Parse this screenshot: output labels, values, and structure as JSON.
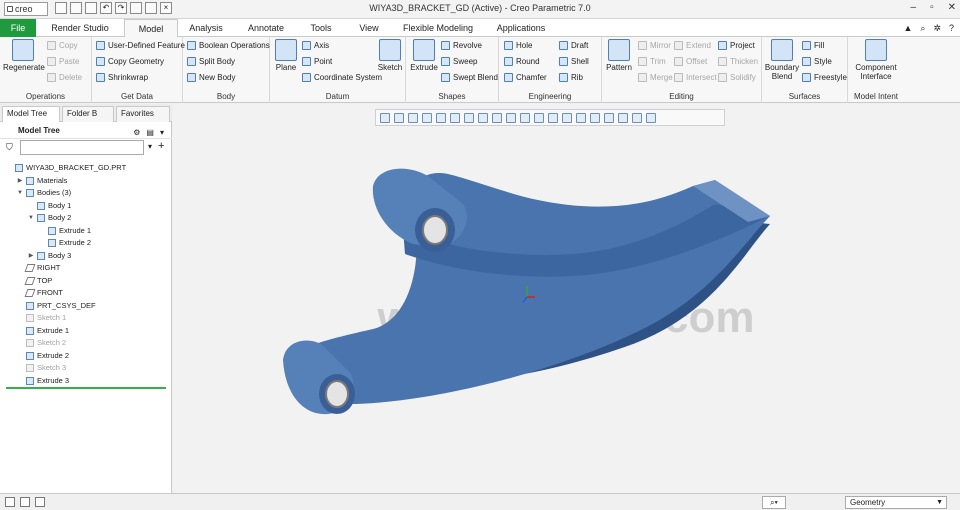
{
  "app": {
    "logo": "creo",
    "window_title": "WIYA3D_BRACKET_GD (Active) - Creo Parametric 7.0",
    "window_controls": [
      "–",
      "▫",
      "✕"
    ]
  },
  "tabs": {
    "file": "File",
    "items": [
      "Render Studio",
      "Model",
      "Analysis",
      "Annotate",
      "Tools",
      "View",
      "Flexible Modeling",
      "Applications"
    ],
    "active": "Model"
  },
  "ribbon": {
    "operations": {
      "label": "Operations",
      "regenerate": "Regenerate",
      "copy": "Copy",
      "paste": "Paste",
      "delete": "Delete"
    },
    "get_data": {
      "label": "Get Data",
      "user_defined": "User-Defined Feature",
      "copy_geometry": "Copy Geometry",
      "shrinkwrap": "Shrinkwrap"
    },
    "body": {
      "label": "Body",
      "boolean": "Boolean Operations",
      "split": "Split Body",
      "new": "New Body"
    },
    "datum": {
      "label": "Datum",
      "plane": "Plane",
      "axis": "Axis",
      "point": "Point",
      "csys": "Coordinate System",
      "sketch": "Sketch"
    },
    "shapes": {
      "label": "Shapes",
      "extrude": "Extrude",
      "revolve": "Revolve",
      "sweep": "Sweep",
      "swept_blend": "Swept Blend"
    },
    "engineering": {
      "label": "Engineering",
      "hole": "Hole",
      "draft": "Draft",
      "round": "Round",
      "shell": "Shell",
      "chamfer": "Chamfer",
      "rib": "Rib"
    },
    "editing": {
      "label": "Editing",
      "pattern": "Pattern",
      "mirror": "Mirror",
      "extend": "Extend",
      "project": "Project",
      "trim": "Trim",
      "offset": "Offset",
      "thicken": "Thicken",
      "merge": "Merge",
      "intersect": "Intersect",
      "solidify": "Solidify"
    },
    "surfaces": {
      "label": "Surfaces",
      "boundary_blend": "Boundary Blend",
      "fill": "Fill",
      "style": "Style",
      "freestyle": "Freestyle"
    },
    "model_intent": {
      "label": "Model Intent",
      "component_interface": "Component Interface"
    }
  },
  "panel": {
    "tabs": [
      "Model Tree",
      "Folder B",
      "Favorites"
    ],
    "header": "Model Tree",
    "search_placeholder": "",
    "tree": [
      {
        "label": "WIYA3D_BRACKET_GD.PRT",
        "indent": 0,
        "toggle": "",
        "icon": "part-icon",
        "dim": false
      },
      {
        "label": "Materials",
        "indent": 1,
        "toggle": "▶",
        "icon": "materials-icon",
        "dim": false
      },
      {
        "label": "Bodies (3)",
        "indent": 1,
        "toggle": "▼",
        "icon": "bodies-icon",
        "dim": false
      },
      {
        "label": "Body 1",
        "indent": 2,
        "toggle": "",
        "icon": "body-icon",
        "dim": false
      },
      {
        "label": "Body 2",
        "indent": 2,
        "toggle": "▼",
        "icon": "body-icon",
        "dim": false
      },
      {
        "label": "Extrude 1",
        "indent": 3,
        "toggle": "",
        "icon": "extrude-icon",
        "dim": false
      },
      {
        "label": "Extrude 2",
        "indent": 3,
        "toggle": "",
        "icon": "extrude-icon",
        "dim": false
      },
      {
        "label": "Body 3",
        "indent": 2,
        "toggle": "▶",
        "icon": "body-icon",
        "dim": false
      },
      {
        "label": "RIGHT",
        "indent": 1,
        "toggle": "",
        "icon": "datum-plane-icon",
        "dim": false
      },
      {
        "label": "TOP",
        "indent": 1,
        "toggle": "",
        "icon": "datum-plane-icon",
        "dim": false
      },
      {
        "label": "FRONT",
        "indent": 1,
        "toggle": "",
        "icon": "datum-plane-icon",
        "dim": false
      },
      {
        "label": "PRT_CSYS_DEF",
        "indent": 1,
        "toggle": "",
        "icon": "csys-icon",
        "dim": false
      },
      {
        "label": "Sketch 1",
        "indent": 1,
        "toggle": "",
        "icon": "sketch-icon",
        "dim": true
      },
      {
        "label": "Extrude 1",
        "indent": 1,
        "toggle": "",
        "icon": "extrude-icon",
        "dim": false
      },
      {
        "label": "Sketch 2",
        "indent": 1,
        "toggle": "",
        "icon": "sketch-icon",
        "dim": true
      },
      {
        "label": "Extrude 2",
        "indent": 1,
        "toggle": "",
        "icon": "extrude-icon",
        "dim": false
      },
      {
        "label": "Sketch 3",
        "indent": 1,
        "toggle": "",
        "icon": "sketch-icon",
        "dim": true
      },
      {
        "label": "Extrude 3",
        "indent": 1,
        "toggle": "",
        "icon": "extrude-icon",
        "dim": false
      }
    ]
  },
  "viewport": {
    "watermark": "www.WiYa3D.com",
    "model_color": "#4a74ad"
  },
  "status": {
    "selection_filter": "Geometry"
  },
  "colors": {
    "file_tab": "#1f9b3e",
    "accent": "#4a74ad"
  }
}
